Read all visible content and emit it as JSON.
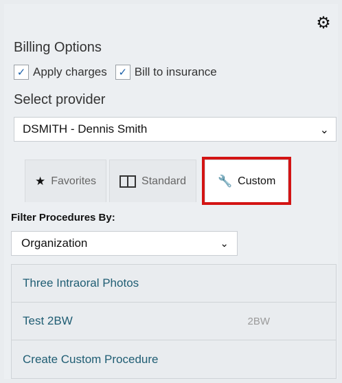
{
  "billing": {
    "title": "Billing Options",
    "apply_charges_label": "Apply charges",
    "apply_charges_checked": true,
    "bill_to_insurance_label": "Bill to insurance",
    "bill_to_insurance_checked": true
  },
  "provider": {
    "title": "Select provider",
    "selected": "DSMITH - Dennis Smith"
  },
  "tabs": [
    {
      "label": "Favorites",
      "icon": "star-icon"
    },
    {
      "label": "Standard",
      "icon": "book-icon"
    },
    {
      "label": "Custom",
      "icon": "wrench-icon",
      "active": true
    }
  ],
  "filter": {
    "label": "Filter Procedures By:",
    "selected": "Organization"
  },
  "procedures": [
    {
      "name": "Three Intraoral Photos",
      "code": ""
    },
    {
      "name": "Test 2BW",
      "code": "2BW"
    },
    {
      "name": "Create Custom Procedure",
      "code": ""
    }
  ],
  "colors": {
    "highlight": "#d31414",
    "link": "#1f5d73",
    "check": "#1a5fa8"
  }
}
